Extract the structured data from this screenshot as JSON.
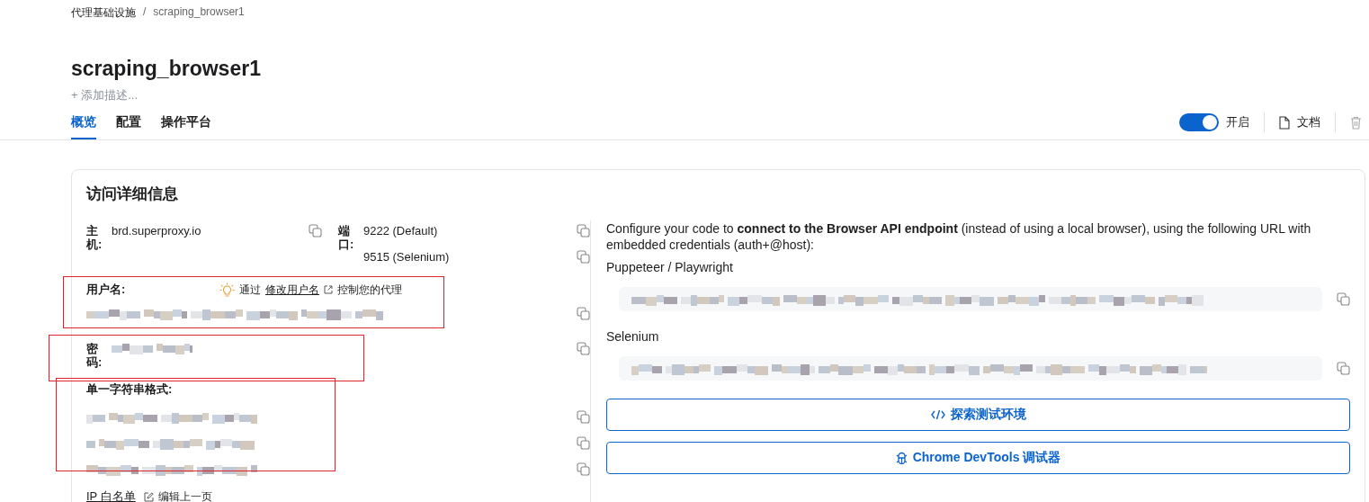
{
  "breadcrumb": {
    "items": [
      "代理基础设施",
      "scraping_browser1"
    ],
    "separator": "/"
  },
  "title": "scraping_browser1",
  "add_description": {
    "icon": "+",
    "label": "添加描述..."
  },
  "tabs": [
    {
      "label": "概览",
      "selected": true
    },
    {
      "label": "配置",
      "selected": false
    },
    {
      "label": "操作平台",
      "selected": false
    }
  ],
  "toolbar": {
    "toggle": {
      "on": true,
      "label": "开启"
    },
    "docs": "文档"
  },
  "card": {
    "title": "访问详细信息",
    "host": {
      "label": "主机:",
      "value": "brd.superproxy.io"
    },
    "port": {
      "label": "端口:",
      "values": [
        "9222 (Default)",
        "9515 (Selenium)"
      ]
    },
    "username": {
      "label": "用户名:",
      "tip_prefix": "通过",
      "tip_link": "修改用户名",
      "tip_suffix": "控制您的代理",
      "highlighted": true
    },
    "password": {
      "label": "密码:",
      "highlighted": true
    },
    "single_string": {
      "label": "单一字符串格式:",
      "highlighted": true
    },
    "ip_whitelist": "IP 白名单",
    "edit": "编辑上一页",
    "intro": "Configure your code to **connect to the Browser API endpoint** (instead of using a local browser), using the following URL with embedded credentials (auth+@host):",
    "endpoints": [
      {
        "label": "Puppeteer / Playwright"
      },
      {
        "label": "Selenium"
      }
    ],
    "buttons": [
      {
        "kind": "code",
        "label": "探索测试环境"
      },
      {
        "kind": "bug",
        "label": "Chrome DevTools 调试器"
      }
    ]
  }
}
